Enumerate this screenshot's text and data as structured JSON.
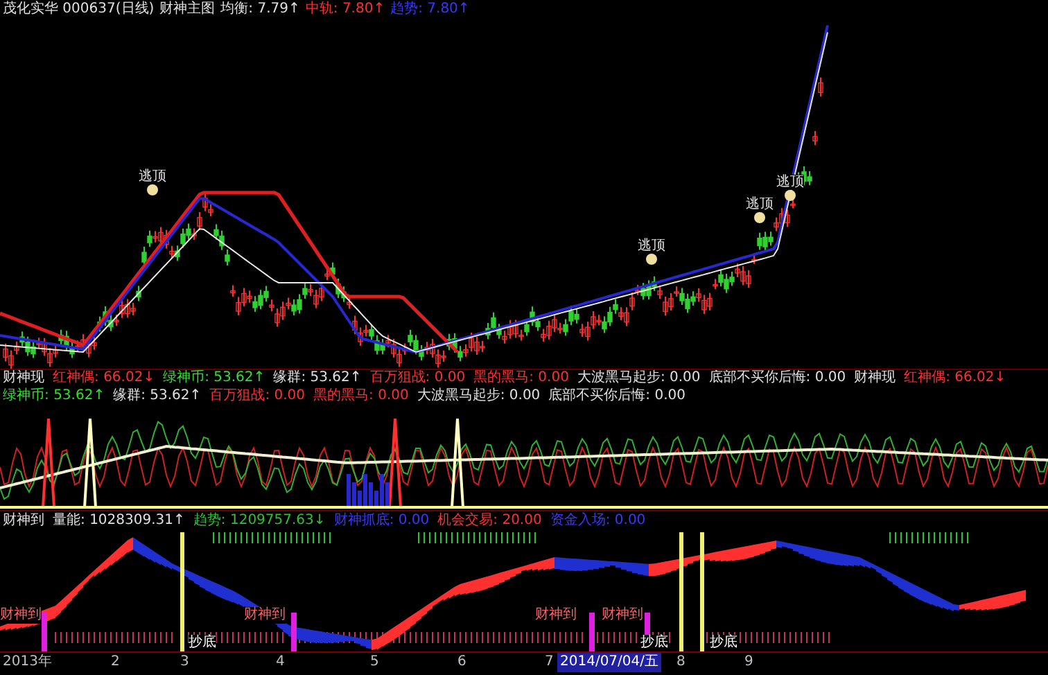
{
  "header": {
    "stock": "茂化实华 000637(日线)",
    "indicator": "财神主图",
    "readings": [
      {
        "label": "均衡:",
        "value": "7.79",
        "arrow": "↑",
        "color": "#e0e0e0"
      },
      {
        "label": "中轨:",
        "value": "7.80",
        "arrow": "↑",
        "color": "#ff3030"
      },
      {
        "label": "趋势:",
        "value": "7.80",
        "arrow": "↑",
        "color": "#3838ff"
      }
    ]
  },
  "price_chart": {
    "markers": [
      "逃顶",
      "逃顶",
      "逃顶",
      "逃顶"
    ]
  },
  "indicator_panel": {
    "groups": [
      {
        "name": "财神现",
        "readings": [
          {
            "label": "红神偶:",
            "value": "66.02",
            "arrow": "↓",
            "color": "#ff3030"
          },
          {
            "label": "绿神币:",
            "value": "53.62",
            "arrow": "↑",
            "color": "#30e030"
          },
          {
            "label": "缘群:",
            "value": "53.62",
            "arrow": "↑",
            "color": "#e0e0e0"
          },
          {
            "label": "百万狙战:",
            "value": "0.00",
            "color": "#ff3030"
          },
          {
            "label": "黑的黑马:",
            "value": "0.00",
            "color": "#ff3030"
          },
          {
            "label": "大波黑马起步:",
            "value": "0.00",
            "color": "#e0e0e0"
          },
          {
            "label": "底部不买你后悔:",
            "value": "0.00",
            "color": "#e0e0e0"
          }
        ]
      },
      {
        "name": "财神现",
        "readings": [
          {
            "label": "红神偶:",
            "value": "66.02",
            "arrow": "↓",
            "color": "#ff3030"
          },
          {
            "label": "绿神币:",
            "value": "53.62",
            "arrow": "↑",
            "color": "#30e030"
          },
          {
            "label": "缘群:",
            "value": "53.62",
            "arrow": "↑",
            "color": "#e0e0e0"
          },
          {
            "label": "百万狙战:",
            "value": "0.00",
            "color": "#ff3030"
          },
          {
            "label": "黑的黑马:",
            "value": "0.00",
            "color": "#ff3030"
          },
          {
            "label": "大波黑马起步:",
            "value": "0.00",
            "color": "#e0e0e0"
          },
          {
            "label": "底部不买你后悔:",
            "value": "0.00",
            "color": "#e0e0e0"
          }
        ]
      }
    ]
  },
  "volume_panel": {
    "name": "财神到",
    "readings": [
      {
        "label": "量能:",
        "value": "1028309.31",
        "arrow": "↑",
        "color": "#e0e0e0"
      },
      {
        "label": "趋势:",
        "value": "1209757.63",
        "arrow": "↓",
        "color": "#30c030"
      },
      {
        "label": "财神抓底:",
        "value": "0.00",
        "color": "#3838ff"
      },
      {
        "label": "机会交易:",
        "value": "20.00",
        "color": "#ff3030"
      },
      {
        "label": "资金入场:",
        "value": "0.00",
        "color": "#3838ff"
      }
    ],
    "signals": [
      "财神到",
      "财神到",
      "财神到",
      "财神到"
    ],
    "tags": [
      "抄底",
      "抄底",
      "抄底"
    ]
  },
  "axis": {
    "labels": [
      "2013年",
      "2",
      "3",
      "4",
      "5",
      "6",
      "7",
      "8",
      "9"
    ],
    "date": "2014/07/04/五"
  }
}
